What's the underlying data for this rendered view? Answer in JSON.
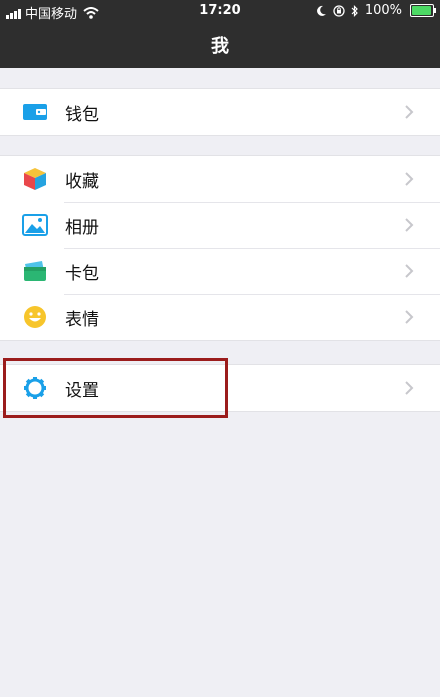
{
  "status_bar": {
    "carrier": "中国移动",
    "time": "17:20",
    "battery_text": "100%"
  },
  "nav": {
    "title": "我"
  },
  "groups": [
    [
      {
        "label": "钱包",
        "icon": "wallet-icon"
      }
    ],
    [
      {
        "label": "收藏",
        "icon": "favorites-cube-icon"
      },
      {
        "label": "相册",
        "icon": "album-image-icon"
      },
      {
        "label": "卡包",
        "icon": "card-wallet-icon"
      },
      {
        "label": "表情",
        "icon": "emoji-face-icon"
      }
    ],
    [
      {
        "label": "设置",
        "icon": "settings-gear-icon"
      }
    ]
  ],
  "colors": {
    "header_bg": "#2e2e2e",
    "page_bg": "#efeff4",
    "highlight_border": "#9b1c1c",
    "battery_fill": "#4cd964"
  }
}
